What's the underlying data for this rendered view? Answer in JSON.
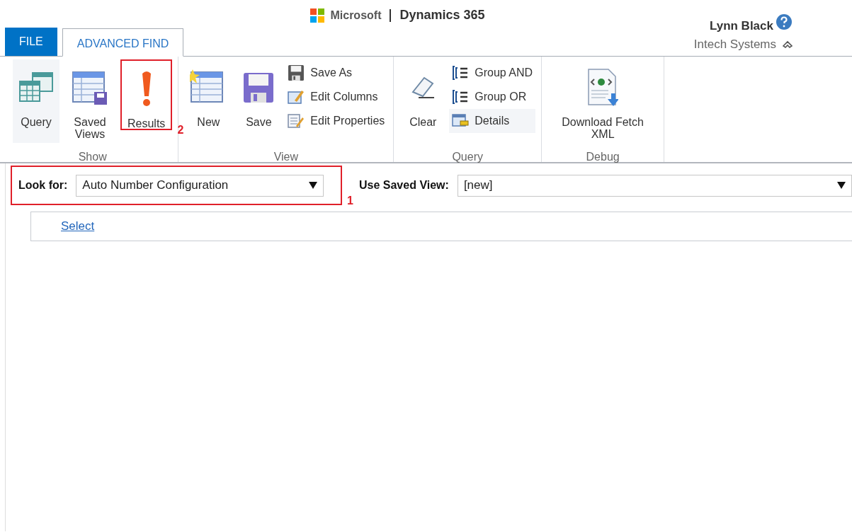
{
  "header": {
    "brand": "Microsoft",
    "product": "Dynamics 365",
    "user": "Lynn Black",
    "organization": "Intech Systems"
  },
  "tabs": [
    {
      "label": "FILE",
      "selected": false,
      "kind": "file"
    },
    {
      "label": "ADVANCED FIND",
      "selected": true,
      "kind": "tab"
    }
  ],
  "ribbon": {
    "groups": [
      {
        "label": "Show",
        "buttons": [
          {
            "kind": "large",
            "label": "Query",
            "highlighted": true
          },
          {
            "kind": "large",
            "label": "Saved Views",
            "highlighted": false
          },
          {
            "kind": "large",
            "label": "Results",
            "highlighted": false,
            "callout": "2"
          }
        ]
      },
      {
        "label": "View",
        "buttons": [
          {
            "kind": "large",
            "label": "New",
            "highlighted": false
          },
          {
            "kind": "large",
            "label": "Save",
            "highlighted": false
          },
          {
            "kind": "small",
            "label": "Save As",
            "highlighted": false
          },
          {
            "kind": "small",
            "label": "Edit Columns",
            "highlighted": false
          },
          {
            "kind": "small",
            "label": "Edit Properties",
            "highlighted": false
          }
        ]
      },
      {
        "label": "Query",
        "buttons": [
          {
            "kind": "large",
            "label": "Clear",
            "highlighted": false
          },
          {
            "kind": "small",
            "label": "Group AND",
            "highlighted": false
          },
          {
            "kind": "small",
            "label": "Group OR",
            "highlighted": false
          },
          {
            "kind": "small",
            "label": "Details",
            "highlighted": true
          }
        ]
      },
      {
        "label": "Debug",
        "buttons": [
          {
            "kind": "large",
            "label": "Download Fetch XML",
            "highlighted": false
          }
        ]
      }
    ]
  },
  "look_for": {
    "label": "Look for:",
    "value": "Auto Number Configuration",
    "callout": "1"
  },
  "saved_view": {
    "label": "Use Saved View:",
    "value": "[new]"
  },
  "select_link": "Select"
}
